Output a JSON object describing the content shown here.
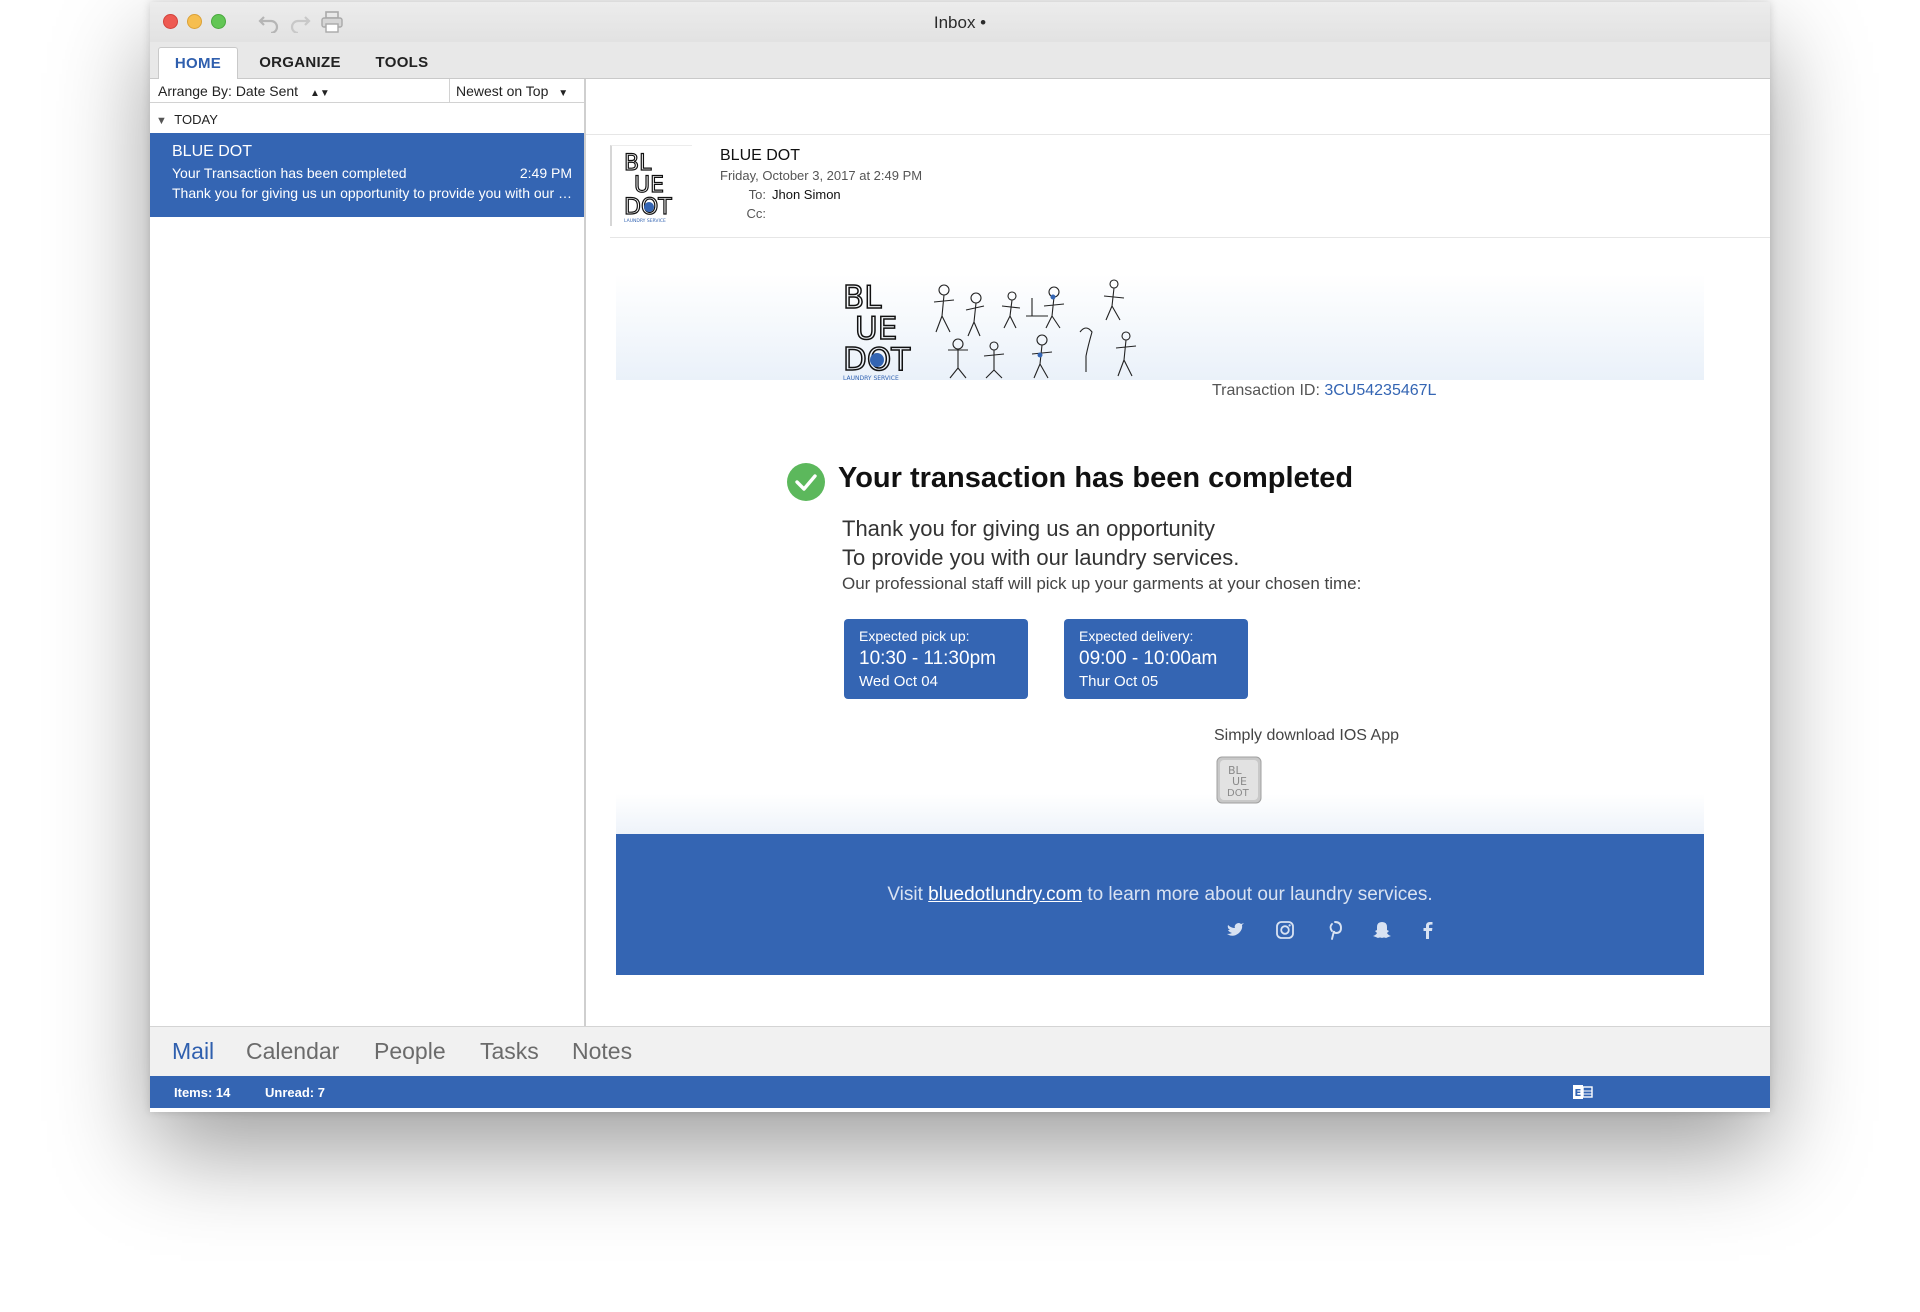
{
  "window": {
    "title": "Inbox •"
  },
  "ribbon": {
    "tabs": [
      "HOME",
      "ORGANIZE",
      "TOOLS"
    ]
  },
  "list": {
    "arrange_by": "Arrange By: Date Sent",
    "order": "Newest on Top",
    "group": "TODAY",
    "messages": [
      {
        "sender": "BLUE DOT",
        "subject": "Your Transaction has been completed",
        "time": "2:49 PM",
        "preview": "Thank you for giving us un opportunity to provide you with our laundry services."
      }
    ]
  },
  "reading": {
    "sender": "BLUE DOT",
    "date": "Friday, October 3, 2017 at 2:49 PM",
    "to_label": "To:",
    "to": "Jhon Simon",
    "cc_label": "Cc:",
    "cc": ""
  },
  "email": {
    "logo_lines": [
      "BL",
      "UE",
      "DOT"
    ],
    "logo_tagline": "LAUNDRY SERVICE",
    "transaction_label": "Transaction ID:",
    "transaction_id": "3CU54235467L",
    "headline": "Your transaction has been completed",
    "thanks_line1": "Thank you for giving us an opportunity",
    "thanks_line2": "To provide you with our laundry services.",
    "staff_line": "Our professional staff will pick up your garments at your chosen time:",
    "pickup": {
      "label": "Expected pick up:",
      "range": "10:30 - 11:30pm",
      "day": "Wed Oct 04"
    },
    "delivery": {
      "label": "Expected delivery:",
      "range": "09:00 - 10:00am",
      "day": "Thur Oct 05"
    },
    "download": "Simply download IOS App",
    "footer_prefix": "Visit",
    "footer_link": "bluedotlundry.com",
    "footer_suffix": "to learn more about our laundry services.",
    "social_icons": [
      "twitter-icon",
      "instagram-icon",
      "pinterest-icon",
      "snapchat-icon",
      "facebook-icon"
    ]
  },
  "nav": {
    "items": [
      "Mail",
      "Calendar",
      "People",
      "Tasks",
      "Notes"
    ]
  },
  "status": {
    "items": "Items: 14",
    "unread": "Unread: 7"
  },
  "colors": {
    "accent": "#3465b3",
    "success": "#5cb85c",
    "link": "#2f5fae"
  }
}
